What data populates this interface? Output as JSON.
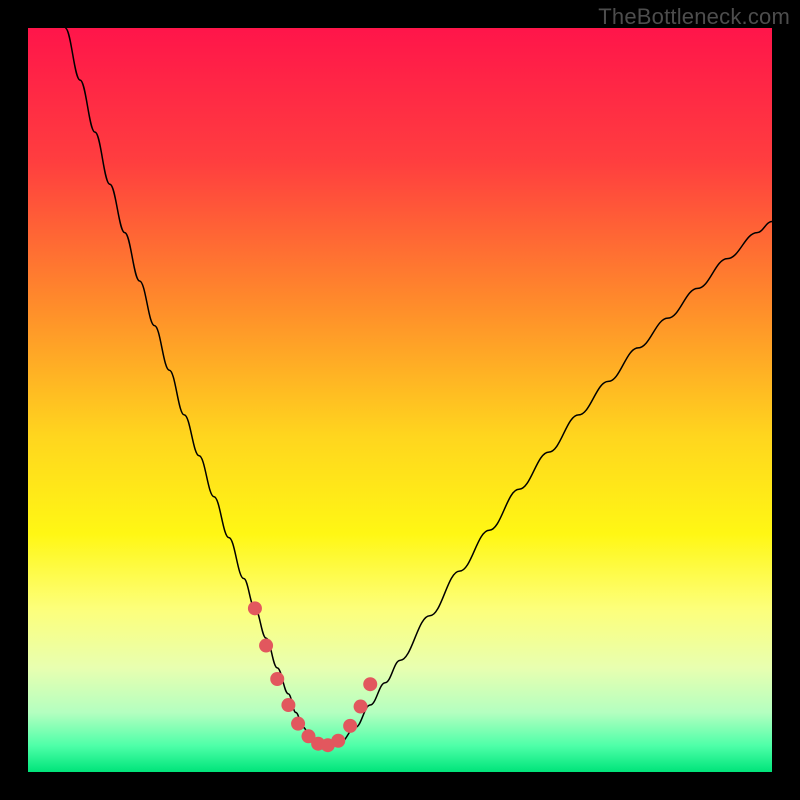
{
  "watermark": "TheBottleneck.com",
  "chart_data": {
    "type": "line",
    "title": "",
    "xlabel": "",
    "ylabel": "",
    "xlim": [
      0,
      100
    ],
    "ylim": [
      0,
      100
    ],
    "gradient_stops": [
      {
        "pos": 0.0,
        "color": "#ff154a"
      },
      {
        "pos": 0.18,
        "color": "#ff3e3f"
      },
      {
        "pos": 0.38,
        "color": "#ff8f2a"
      },
      {
        "pos": 0.55,
        "color": "#ffd61e"
      },
      {
        "pos": 0.68,
        "color": "#fff714"
      },
      {
        "pos": 0.78,
        "color": "#fdff7a"
      },
      {
        "pos": 0.86,
        "color": "#e8ffb0"
      },
      {
        "pos": 0.92,
        "color": "#b4ffc0"
      },
      {
        "pos": 0.965,
        "color": "#4dffa8"
      },
      {
        "pos": 1.0,
        "color": "#00e47a"
      }
    ],
    "series": [
      {
        "name": "bottleneck-curve",
        "color": "#000000",
        "width": 1.5,
        "x": [
          5,
          7,
          9,
          11,
          13,
          15,
          17,
          19,
          21,
          23,
          25,
          27,
          29,
          30.5,
          32,
          33.5,
          35,
          36,
          37,
          38,
          40,
          42,
          44,
          46,
          48,
          50,
          54,
          58,
          62,
          66,
          70,
          74,
          78,
          82,
          86,
          90,
          94,
          98,
          100
        ],
        "y": [
          100,
          93,
          86,
          79,
          72.5,
          66,
          60,
          54,
          48,
          42.5,
          37,
          31.5,
          26,
          22,
          18,
          14,
          10.5,
          8,
          6,
          4.5,
          3,
          4,
          6,
          9,
          12,
          15,
          21,
          27,
          32.5,
          38,
          43,
          48,
          52.5,
          57,
          61,
          65,
          69,
          72.5,
          74
        ]
      },
      {
        "name": "highlight-dots",
        "color": "#e2575e",
        "type": "dotted",
        "radius": 7,
        "x": [
          30.5,
          32,
          33.5,
          35,
          36.3,
          37.7,
          39,
          40.3,
          41.7,
          43.3,
          44.7,
          46
        ],
        "y": [
          22,
          17,
          12.5,
          9,
          6.5,
          4.8,
          3.8,
          3.6,
          4.2,
          6.2,
          8.8,
          11.8
        ]
      }
    ]
  }
}
